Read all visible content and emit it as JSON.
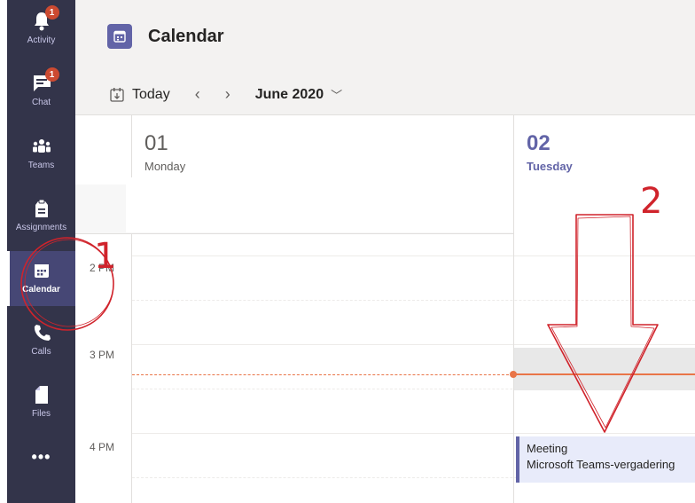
{
  "rail": {
    "items": [
      {
        "label": "Activity",
        "badge": "1",
        "icon": "bell-icon"
      },
      {
        "label": "Chat",
        "badge": "1",
        "icon": "chat-icon"
      },
      {
        "label": "Teams",
        "icon": "teams-icon"
      },
      {
        "label": "Assignments",
        "icon": "assignments-icon"
      },
      {
        "label": "Calendar",
        "icon": "calendar-icon",
        "active": true
      },
      {
        "label": "Calls",
        "icon": "phone-icon"
      },
      {
        "label": "Files",
        "icon": "file-icon"
      }
    ],
    "more": "•••"
  },
  "header": {
    "title": "Calendar"
  },
  "toolbar": {
    "today": "Today",
    "prev": "‹",
    "next": "›",
    "month": "June 2020"
  },
  "days": [
    {
      "num": "01",
      "name": "Monday"
    },
    {
      "num": "02",
      "name": "Tuesday"
    }
  ],
  "hours": [
    "2 PM",
    "3 PM",
    "4 PM"
  ],
  "meeting": {
    "title": "Meeting",
    "subtitle": "Microsoft Teams-vergadering"
  },
  "annotations": [
    "1",
    "2"
  ],
  "colors": {
    "rail": "#33344a",
    "accent": "#6264a7",
    "now_line": "#e97548",
    "annotation": "#d0232b"
  }
}
